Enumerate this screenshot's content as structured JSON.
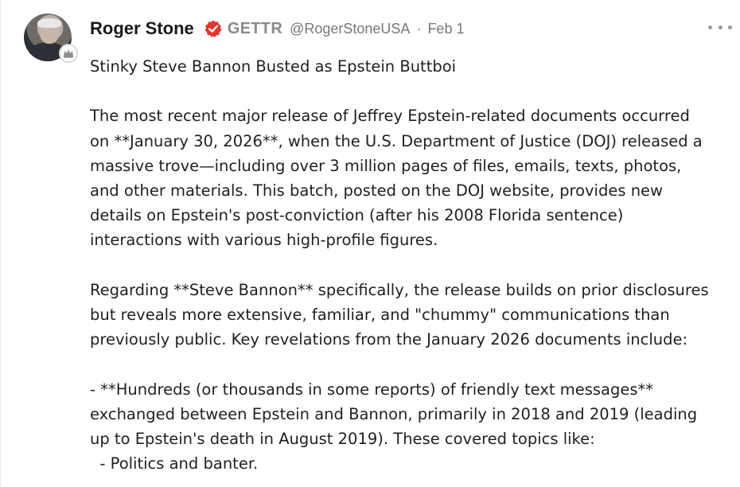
{
  "post": {
    "author_name": "Roger Stone",
    "platform_label": "GETTR",
    "handle": "@RogerStoneUSA",
    "separator": "·",
    "date": "Feb 1",
    "icons": {
      "avatar": "avatar-photo",
      "influencer_badge": "crown-badge-icon",
      "verified": "verified-check-icon",
      "more": "more-options-icon"
    },
    "colors": {
      "verified": "#e8332a",
      "muted": "#777777"
    },
    "lines": [
      "Stinky Steve Bannon Busted as Epstein Buttboi",
      "",
      "The most recent major release of Jeffrey Epstein-related documents occurred",
      "on **January 30, 2026**, when the U.S. Department of Justice (DOJ) released a",
      "massive trove—including over 3 million pages of files, emails, texts, photos,",
      "and other materials. This batch, posted on the DOJ website, provides new",
      "details on Epstein's post-conviction (after his 2008 Florida sentence)",
      "interactions with various high-profile figures.",
      "",
      "Regarding **Steve Bannon** specifically, the release builds on prior disclosures",
      "but reveals more extensive, familiar, and \"chummy\" communications than",
      "previously public. Key revelations from the January 2026 documents include:",
      "",
      "- **Hundreds (or thousands in some reports) of friendly text messages**",
      "exchanged between Epstein and Bannon, primarily in 2018 and 2019 (leading",
      "up to Epstein's death in August 2019). These covered topics like:",
      "  - Politics and banter."
    ]
  }
}
